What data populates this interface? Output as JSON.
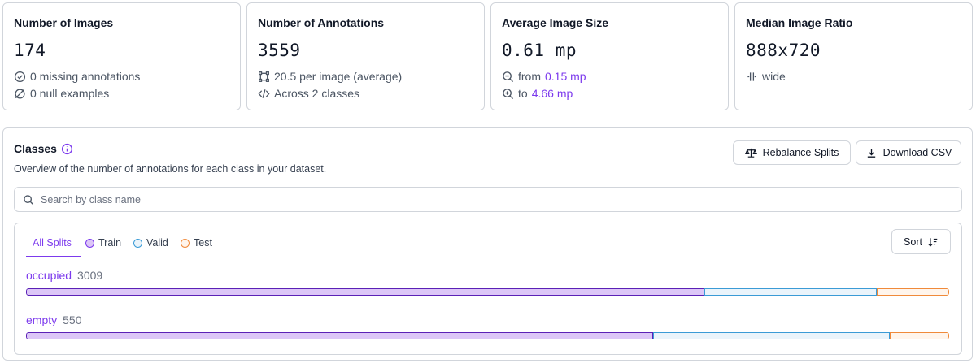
{
  "stats": [
    {
      "title": "Number of Images",
      "value": "174",
      "lines": [
        {
          "icon": "check-circle-icon",
          "text": "0 missing annotations"
        },
        {
          "icon": "null-set-icon",
          "text": "0 null examples"
        }
      ]
    },
    {
      "title": "Number of Annotations",
      "value": "3559",
      "lines": [
        {
          "icon": "bounding-box-icon",
          "text": "20.5 per image (average)"
        },
        {
          "icon": "code-icon",
          "text": "Across 2 classes"
        }
      ]
    },
    {
      "title": "Average Image Size",
      "value": "0.61 mp",
      "lines": [
        {
          "icon": "zoom-out-icon",
          "prefix": "from",
          "value": "0.15 mp"
        },
        {
          "icon": "zoom-in-icon",
          "prefix": "to",
          "value": "4.66 mp"
        }
      ]
    },
    {
      "title": "Median Image Ratio",
      "value": "888x720",
      "lines": [
        {
          "icon": "ratio-wide-icon",
          "text": "wide"
        }
      ]
    }
  ],
  "classes": {
    "title": "Classes",
    "subtitle": "Overview of the number of annotations for each class in your dataset.",
    "rebalance_label": "Rebalance Splits",
    "download_label": "Download CSV",
    "search_placeholder": "Search by class name",
    "tabs": [
      {
        "label": "All Splits",
        "active": true
      },
      {
        "label": "Train",
        "color": "#a855f7"
      },
      {
        "label": "Valid",
        "color": "#3b9bd6"
      },
      {
        "label": "Test",
        "color": "#f08a3a"
      }
    ],
    "sort_label": "Sort",
    "rows": [
      {
        "name": "occupied",
        "count": "3009",
        "split_fractions": {
          "train": 0.735,
          "valid": 0.187,
          "test": 0.078
        }
      },
      {
        "name": "empty",
        "count": "550",
        "split_fractions": {
          "train": 0.679,
          "valid": 0.257,
          "test": 0.064
        }
      }
    ]
  },
  "colors": {
    "accent": "#7c3aed",
    "border": "#d1d5db"
  }
}
